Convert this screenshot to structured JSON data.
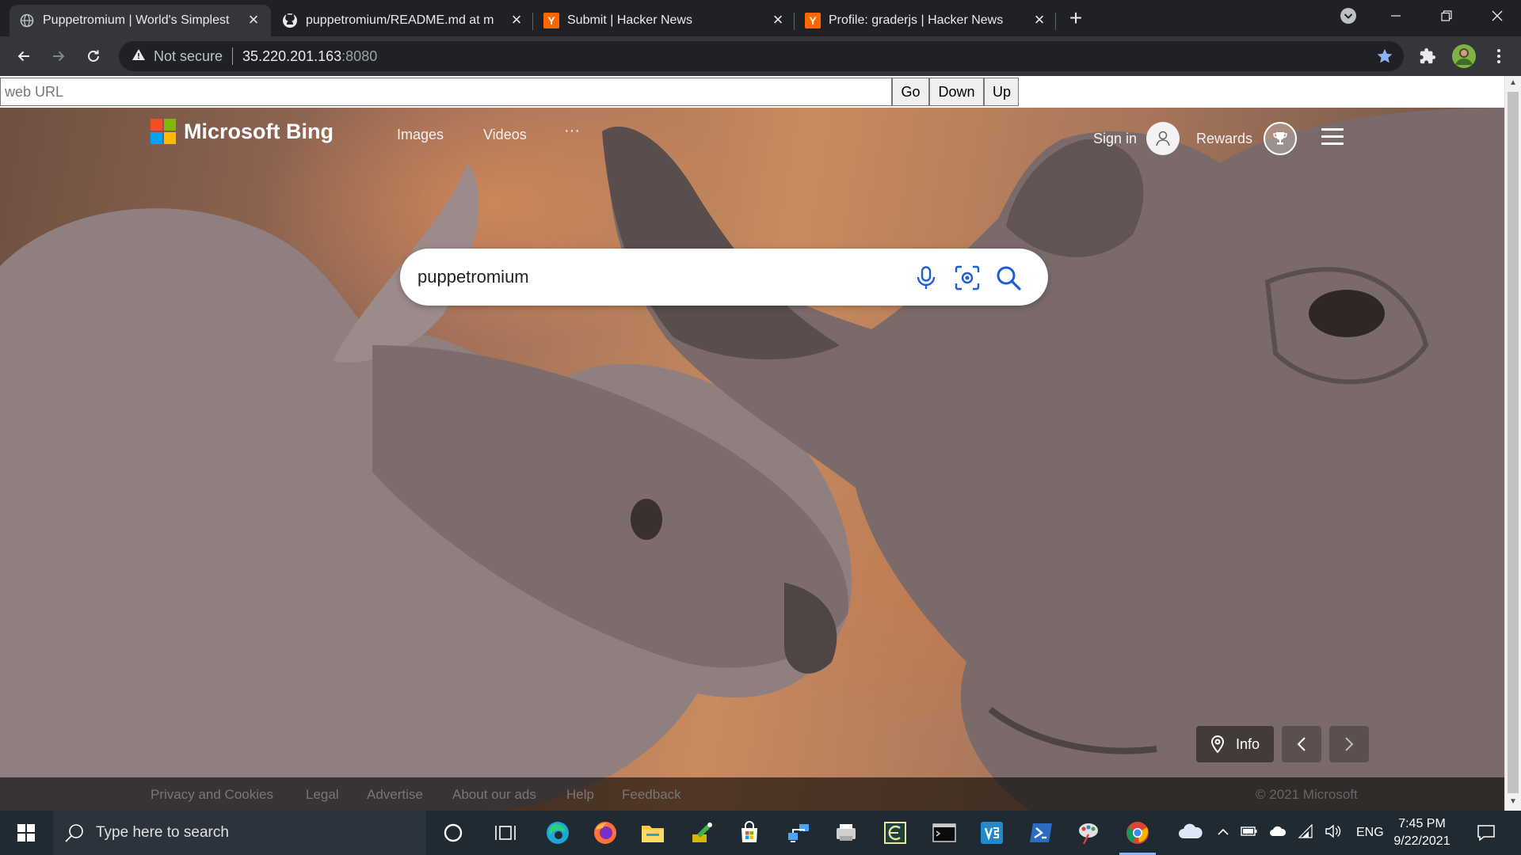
{
  "browser": {
    "tabs": [
      {
        "title": "Puppetromium | World's Simplest",
        "favicon": "globe-icon",
        "active": true
      },
      {
        "title": "puppetromium/README.md at m",
        "favicon": "github-icon",
        "active": false
      },
      {
        "title": "Submit | Hacker News",
        "favicon": "hacker-news-icon",
        "favicon_text": "Y",
        "active": false
      },
      {
        "title": "Profile: graderjs | Hacker News",
        "favicon": "hacker-news-icon",
        "favicon_text": "Y",
        "active": false
      }
    ],
    "new_tab": "+",
    "omnibox": {
      "security_label": "Not secure",
      "host": "35.220.201.163",
      "port": ":8080"
    },
    "colors": {
      "frame": "#202124",
      "toolbar": "#35363a",
      "star": "#8ab4f8"
    }
  },
  "webbar": {
    "url_placeholder": "web URL",
    "url_value": "",
    "go_label": "Go",
    "down_label": "Down",
    "up_label": "Up"
  },
  "bing": {
    "brand": "Microsoft Bing",
    "nav": [
      "Images",
      "Videos",
      "···"
    ],
    "sign_in": "Sign in",
    "rewards": "Rewards",
    "search_value": "puppetromium",
    "info_label": "Info",
    "footer_links": [
      "Privacy and Cookies",
      "Legal",
      "Advertise",
      "About our ads",
      "Help",
      "Feedback"
    ],
    "copyright": "© 2021 Microsoft",
    "logo_colors": [
      "#f25022",
      "#7fba00",
      "#00a4ef",
      "#ffb900"
    ]
  },
  "taskbar": {
    "search_placeholder": "Type here to search",
    "language": "ENG",
    "time": "7:45 PM",
    "date": "9/22/2021",
    "pinned": [
      "cortana-icon",
      "task-view-icon",
      "edge-icon",
      "firefox-icon",
      "file-explorer-icon",
      "tool-icon",
      "store-icon",
      "network-icon",
      "scanner-icon",
      "app-icon",
      "terminal-icon",
      "vscode-icon",
      "powershell-icon",
      "paint-icon",
      "chrome-icon"
    ]
  }
}
